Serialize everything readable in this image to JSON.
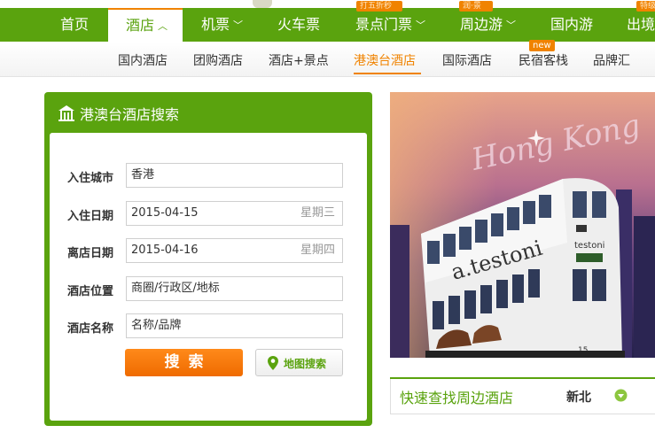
{
  "nav": {
    "items": [
      {
        "label": "首页"
      },
      {
        "label": "酒店",
        "active": true,
        "dropdown": true
      },
      {
        "label": "机票",
        "dropdown": true
      },
      {
        "label": "火车票"
      },
      {
        "label": "景点门票",
        "dropdown": true
      },
      {
        "label": "周边游",
        "dropdown": true
      },
      {
        "label": "国内游"
      },
      {
        "label": "出境"
      }
    ],
    "promo_tags": [
      "打五折秒",
      "润·景",
      "特级"
    ],
    "accent_color": "#5aa30e",
    "highlight_color": "#f08300"
  },
  "subnav": {
    "items": [
      {
        "label": "国内酒店"
      },
      {
        "label": "团购酒店"
      },
      {
        "label": "酒店+景点"
      },
      {
        "label": "港澳台酒店",
        "active": true
      },
      {
        "label": "国际酒店"
      },
      {
        "label": "民宿客栈"
      },
      {
        "label": "品牌汇"
      }
    ],
    "new_badge": "new"
  },
  "search": {
    "title": "港澳台酒店搜索",
    "icon": "hotel-icon",
    "fields": [
      {
        "label": "入住城市",
        "value": "香港"
      },
      {
        "label": "入住日期",
        "value": "2015-04-15",
        "weekday": "星期三"
      },
      {
        "label": "离店日期",
        "value": "2015-04-16",
        "weekday": "星期四"
      },
      {
        "label": "酒店位置",
        "placeholder": "商圈/行政区/地标"
      },
      {
        "label": "酒店名称",
        "placeholder": "名称/品牌"
      }
    ],
    "search_button": "搜索",
    "map_button": "地图搜索",
    "map_icon": "map-pin-icon"
  },
  "banner": {
    "script_text": "Hong Kong",
    "tram_ad": "a.testoni",
    "tram_ad_side": "testoni",
    "tram_number": "15"
  },
  "nearby": {
    "title": "快速查找周边酒店",
    "city": "新北",
    "dropdown_icon": "chevron-down-icon"
  }
}
